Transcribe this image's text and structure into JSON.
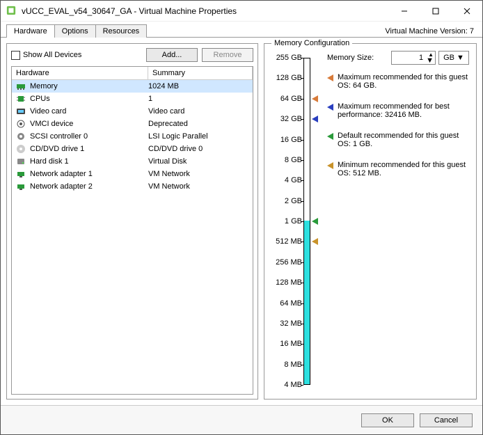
{
  "window": {
    "title": "vUCC_EVAL_v54_30647_GA - Virtual Machine Properties"
  },
  "tabs": {
    "items": [
      "Hardware",
      "Options",
      "Resources"
    ],
    "active": 0
  },
  "version_label": "Virtual Machine Version: 7",
  "left": {
    "show_all": "Show All Devices",
    "add": "Add...",
    "remove": "Remove",
    "col_hardware": "Hardware",
    "col_summary": "Summary",
    "rows": [
      {
        "icon": "memory",
        "h": "Memory",
        "s": "1024 MB",
        "sel": true
      },
      {
        "icon": "cpu",
        "h": "CPUs",
        "s": "1"
      },
      {
        "icon": "video",
        "h": "Video card",
        "s": "Video card"
      },
      {
        "icon": "vmci",
        "h": "VMCI device",
        "s": "Deprecated"
      },
      {
        "icon": "scsi",
        "h": "SCSI controller 0",
        "s": "LSI Logic Parallel"
      },
      {
        "icon": "cd",
        "h": "CD/DVD drive 1",
        "s": "CD/DVD drive 0"
      },
      {
        "icon": "disk",
        "h": "Hard disk 1",
        "s": "Virtual Disk"
      },
      {
        "icon": "nic",
        "h": "Network adapter 1",
        "s": "VM Network"
      },
      {
        "icon": "nic",
        "h": "Network adapter 2",
        "s": "VM Network"
      }
    ]
  },
  "memory": {
    "legend": "Memory Configuration",
    "size_label": "Memory Size:",
    "size_value": "1",
    "unit": "GB",
    "ticks": [
      "255 GB",
      "128 GB",
      "64 GB",
      "32 GB",
      "16 GB",
      "8 GB",
      "4 GB",
      "2 GB",
      "1 GB",
      "512 MB",
      "256 MB",
      "128 MB",
      "64 MB",
      "32 MB",
      "16 MB",
      "8 MB",
      "4 MB"
    ],
    "markers": [
      {
        "color": "#d87b3a",
        "dir": "l",
        "tick": 2
      },
      {
        "color": "#2a3fbf",
        "dir": "l",
        "tick": 3
      },
      {
        "color": "#2a9a3a",
        "dir": "l",
        "tick": 8
      },
      {
        "color": "#c9932b",
        "dir": "l",
        "tick": 9
      }
    ],
    "fill_from_tick": 8,
    "notes": [
      {
        "color": "#d87b3a",
        "text": "Maximum recommended for this guest OS: 64 GB."
      },
      {
        "color": "#2a3fbf",
        "text": "Maximum recommended for best performance: 32416 MB."
      },
      {
        "color": "#2a9a3a",
        "text": "Default recommended for this guest OS: 1 GB."
      },
      {
        "color": "#c9932b",
        "text": "Minimum recommended for this guest OS: 512 MB."
      }
    ]
  },
  "footer": {
    "ok": "OK",
    "cancel": "Cancel"
  },
  "chevron": "▾",
  "spinner": "⯅⯆"
}
